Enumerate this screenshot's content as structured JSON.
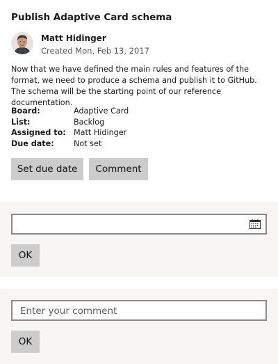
{
  "card": {
    "title": "Publish Adaptive Card schema",
    "author": "Matt Hidinger",
    "created": "Created Mon, Feb 13, 2017",
    "description": "Now that we have defined the main rules and features of the format, we need to produce a schema and publish it to GitHub. The schema will be the starting point of our reference documentation.",
    "avatar_icon": "person-photo",
    "facts": [
      {
        "label": "Board:",
        "value": "Adaptive Card"
      },
      {
        "label": "List:",
        "value": "Backlog"
      },
      {
        "label": "Assigned to:",
        "value": "Matt Hidinger"
      },
      {
        "label": "Due date:",
        "value": "Not set"
      }
    ],
    "actions": {
      "set_due_date": "Set due date",
      "comment": "Comment"
    }
  },
  "due_date_panel": {
    "date_value": "",
    "calendar_icon": "calendar-icon",
    "ok_label": "OK"
  },
  "comment_panel": {
    "placeholder": "Enter your comment",
    "value": "",
    "ok_label": "OK"
  },
  "colors": {
    "button_bg": "#cccccc",
    "panel_bg": "#f7f6f4",
    "field_border": "#8a8a8a"
  }
}
